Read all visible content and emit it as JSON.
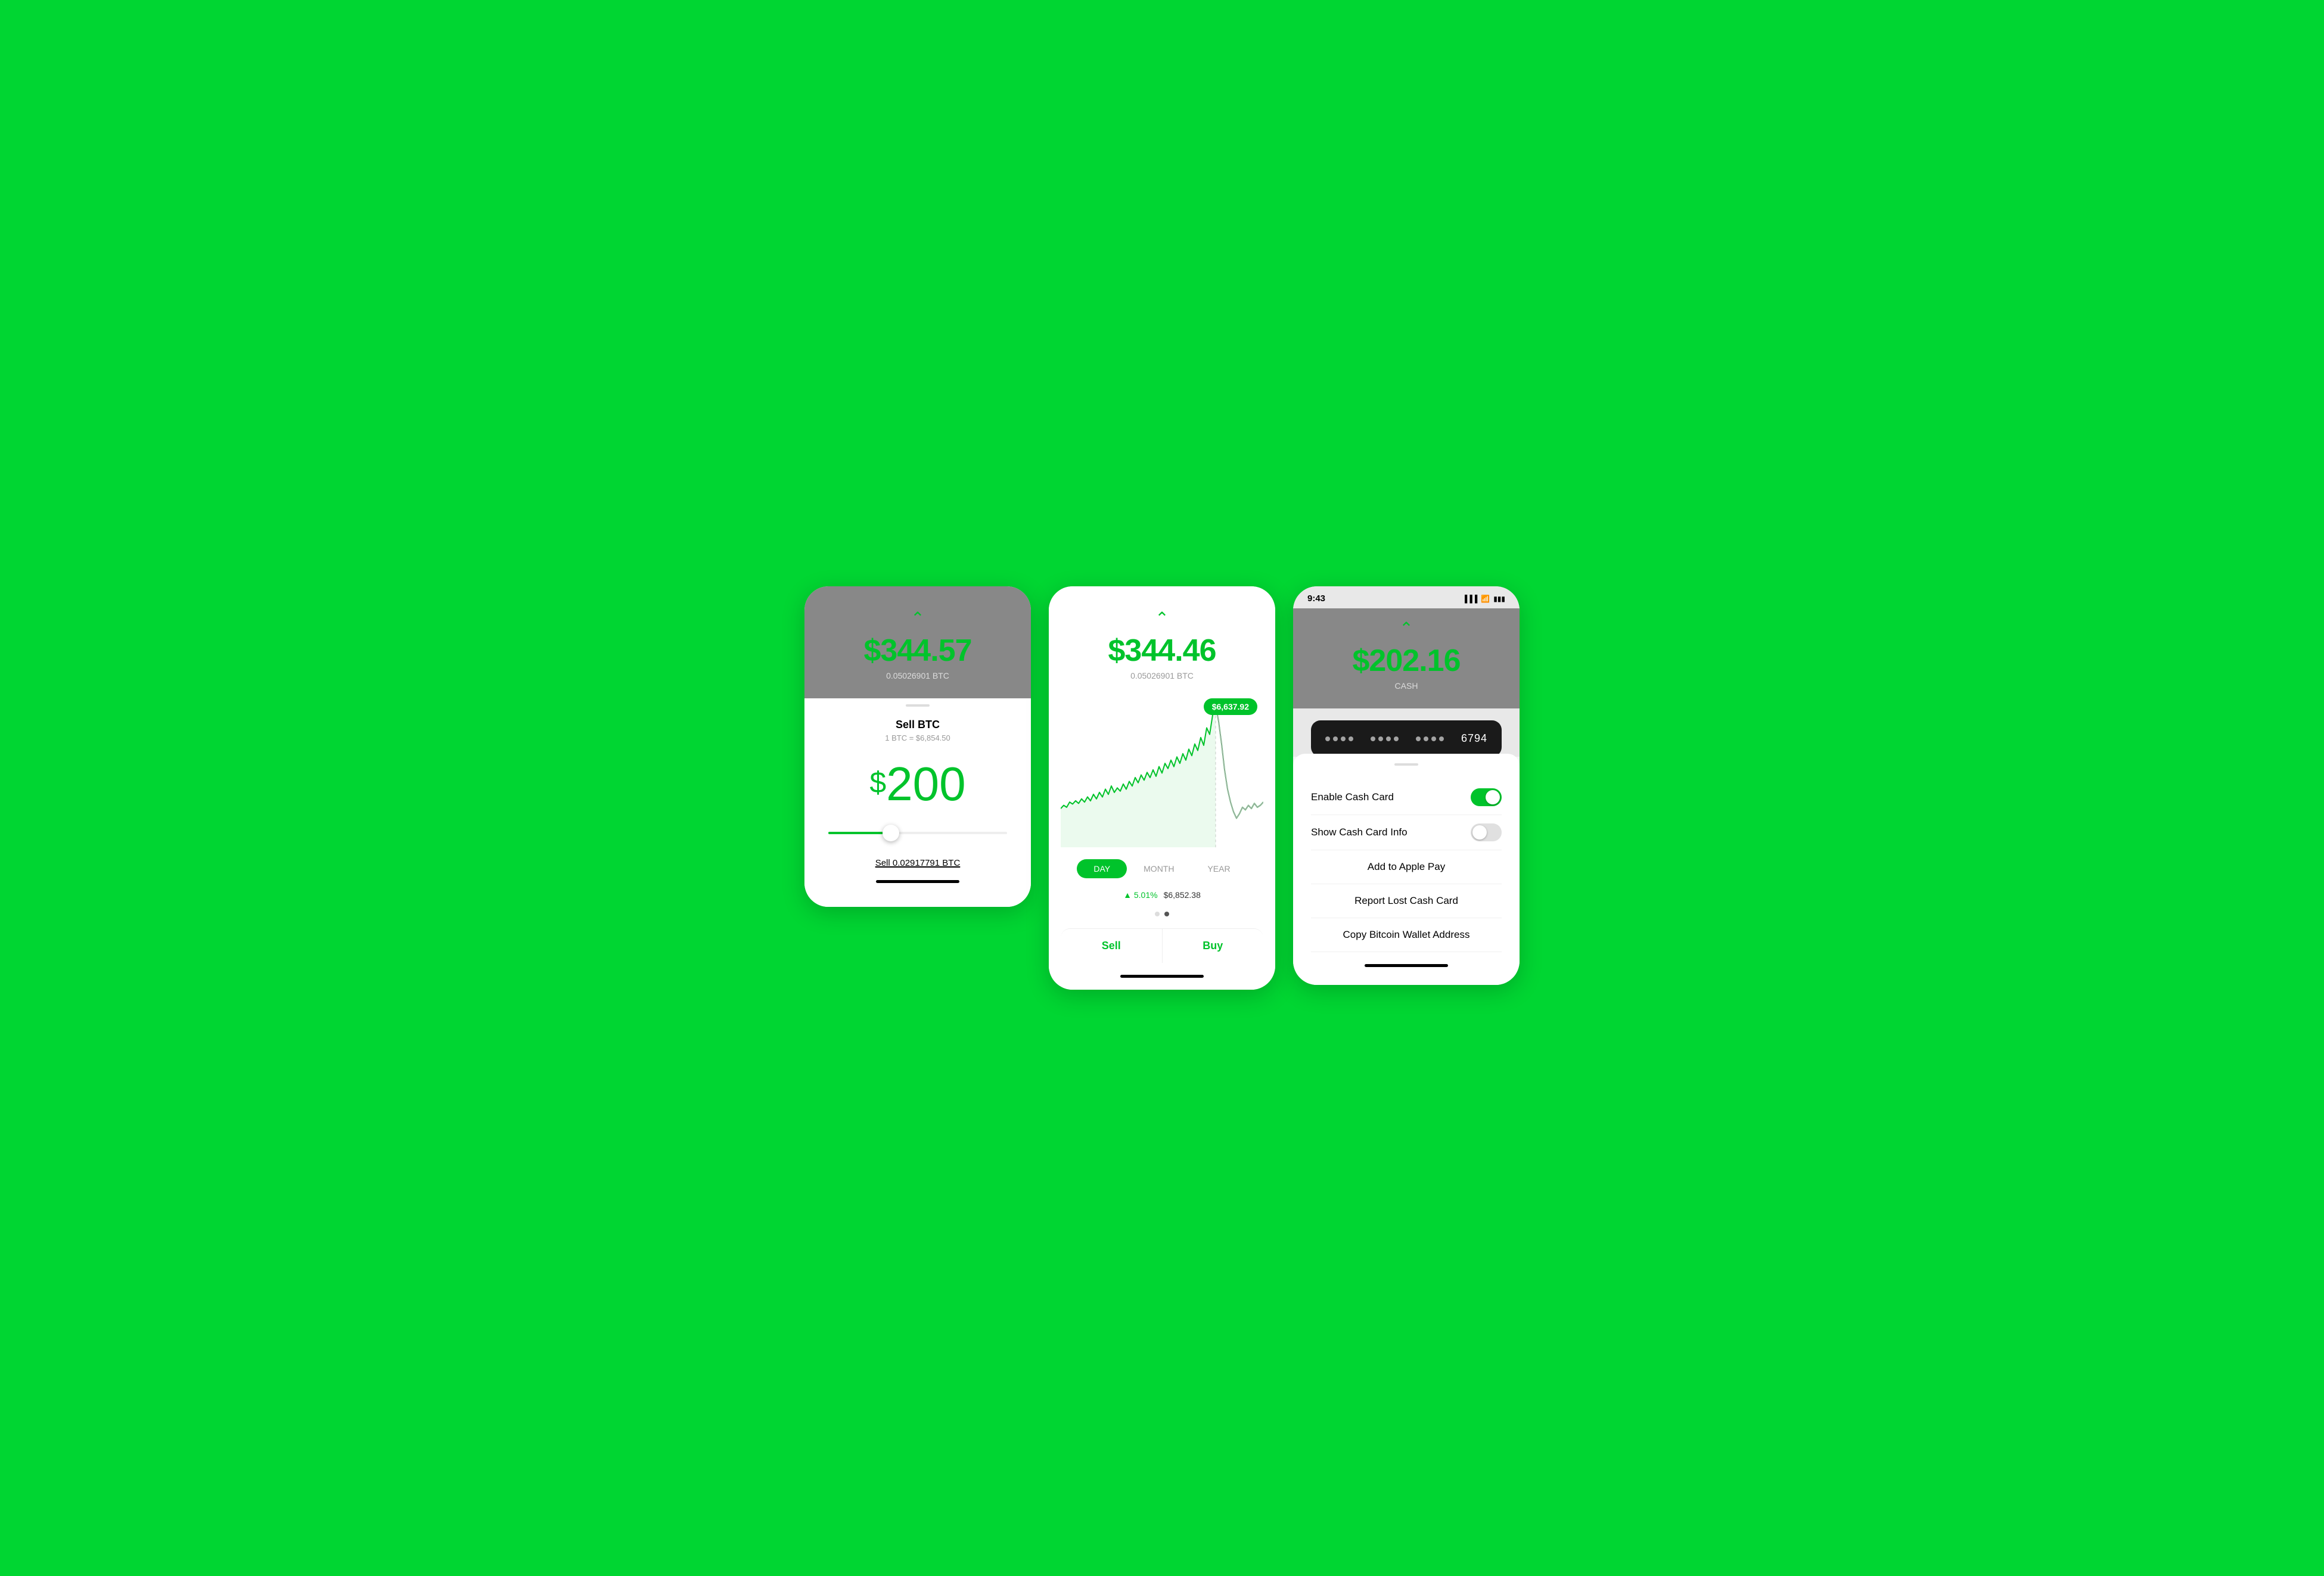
{
  "screen1": {
    "btc_price": "$344.57",
    "btc_amount": "0.05026901 BTC",
    "title": "Sell BTC",
    "rate": "1 BTC = $6,854.50",
    "amount_dollar": "$",
    "amount_number": "200",
    "sell_label": "Sell 0.02917791 BTC"
  },
  "screen2": {
    "btc_price": "$344.46",
    "btc_amount": "0.05026901 BTC",
    "tooltip_price": "$6,637.92",
    "time_buttons": [
      {
        "label": "DAY",
        "active": true
      },
      {
        "label": "MONTH",
        "active": false
      },
      {
        "label": "YEAR",
        "active": false
      }
    ],
    "stat_change": "▲ 5.01%",
    "stat_price": "$6,852.38",
    "sell_btn": "Sell",
    "buy_btn": "Buy"
  },
  "screen3": {
    "status_time": "9:43",
    "balance": "$202.16",
    "balance_label": "CASH",
    "card_last4": "6794",
    "enable_cash_card": "Enable Cash Card",
    "show_cash_card_info": "Show Cash Card Info",
    "add_to_apple_pay": "Add to Apple Pay",
    "report_lost": "Report Lost Cash Card",
    "copy_bitcoin": "Copy Bitcoin Wallet Address"
  },
  "colors": {
    "green": "#00C32B",
    "bg_green": "#00D632"
  }
}
